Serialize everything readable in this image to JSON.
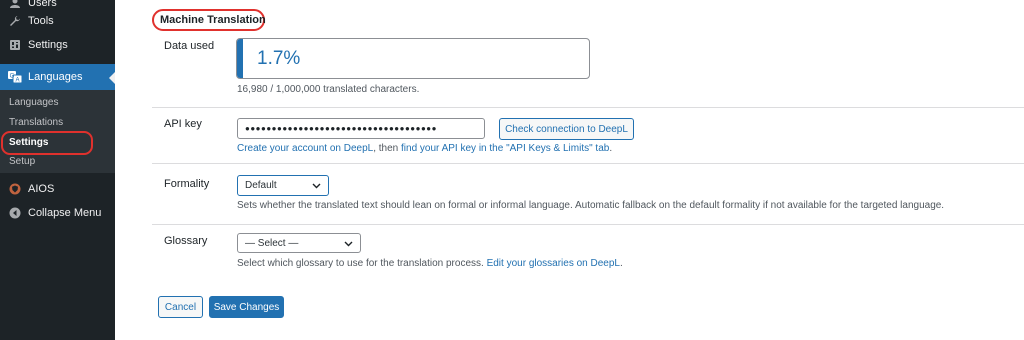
{
  "sidebar": {
    "items": [
      {
        "label": "Users",
        "icon": "users-icon"
      },
      {
        "label": "Tools",
        "icon": "wrench-icon"
      },
      {
        "label": "Settings",
        "icon": "settings-icon"
      },
      {
        "label": "Languages",
        "icon": "languages-icon",
        "current": true
      },
      {
        "label": "AIOS",
        "icon": "aios-shield-icon"
      },
      {
        "label": "Collapse Menu",
        "icon": "collapse-arrow-icon"
      }
    ],
    "submenu": [
      {
        "label": "Languages"
      },
      {
        "label": "Translations"
      },
      {
        "label": "Settings",
        "active": true
      },
      {
        "label": "Setup"
      }
    ]
  },
  "section": {
    "title": "Machine Translation"
  },
  "data_used": {
    "label": "Data used",
    "percent_text": "1.7%",
    "percent_value": 1.7,
    "characters_text": "16,980 / 1,000,000 translated characters."
  },
  "api_key": {
    "label": "API key",
    "masked_value": "●●●●●●●●●●●●●●●●●●●●●●●●●●●●●●●●●●●●",
    "check_button": "Check connection to DeepL",
    "help_link1": "Create your account on DeepL",
    "help_text": ", then ",
    "help_link2": "find your API key in the \"API Keys & Limits\" tab",
    "help_end": "."
  },
  "formality": {
    "label": "Formality",
    "selected": "Default",
    "description": "Sets whether the translated text should lean on formal or informal language. Automatic fallback on the default formality if not available for the targeted language."
  },
  "glossary": {
    "label": "Glossary",
    "selected": "— Select —",
    "description": "Select which glossary to use for the translation process. ",
    "link": "Edit your glossaries on DeepL",
    "end": "."
  },
  "buttons": {
    "cancel": "Cancel",
    "save": "Save Changes"
  },
  "colors": {
    "accent": "#2271b1",
    "sidebar_bg": "#1d2327",
    "highlight_ring": "#e0312d"
  }
}
